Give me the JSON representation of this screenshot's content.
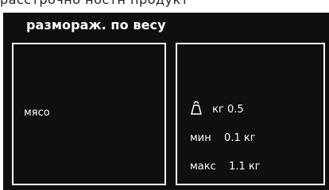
{
  "top_fragment": "расстрочно ностн продукт",
  "screen": {
    "title": "размораж. по весу",
    "food_type": "мясо",
    "weight": {
      "icon": "weight-icon",
      "unit": "кг",
      "value": "0.5"
    },
    "min": {
      "label": "мин",
      "value": "0.1 кг"
    },
    "max": {
      "label": "макс",
      "value": "1.1 кг"
    }
  }
}
